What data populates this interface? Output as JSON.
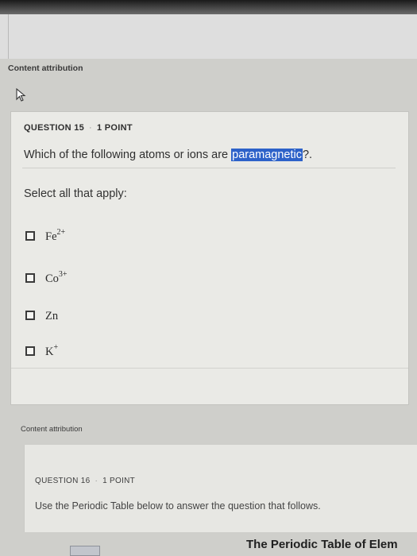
{
  "content_attribution_label": "Content attribution",
  "question15": {
    "number": "QUESTION 15",
    "separator": "·",
    "points": "1 POINT",
    "text_before": "Which of the following atoms or ions are ",
    "highlighted": "paramagnetic",
    "text_after": "?.",
    "instruction": "Select all that apply:",
    "options": [
      {
        "base": "Fe",
        "sup": "2+"
      },
      {
        "base": "Co",
        "sup": "3+"
      },
      {
        "base": "Zn",
        "sup": ""
      },
      {
        "base": "K",
        "sup": "+"
      }
    ]
  },
  "content_attribution_label_2": "Content attribution",
  "question16": {
    "number": "QUESTION 16",
    "separator": "·",
    "points": "1 POINT",
    "text": "Use the Periodic Table below to answer the question that follows."
  },
  "periodic_table_title": "The Periodic Table of Elem",
  "colors": {
    "highlight": "#2d62c9",
    "card_bg": "#eaeae6"
  },
  "icons": {
    "cursor": "mouse-pointer-icon",
    "checkbox": "checkbox-empty-icon"
  }
}
